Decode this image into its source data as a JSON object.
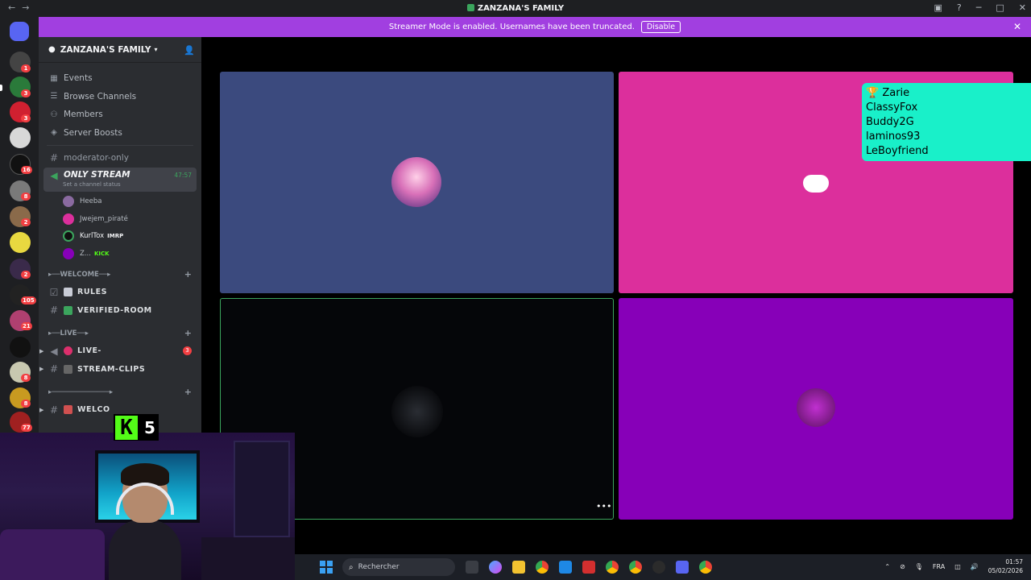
{
  "titlebar": {
    "title": "ZANZANA'S FAMILY"
  },
  "banner": {
    "text": "Streamer Mode is enabled. Usernames have been truncated.",
    "disable_label": "Disable"
  },
  "server": {
    "name": "ZANZANA'S FAMILY",
    "menu": [
      {
        "label": "Events",
        "icon": "calendar-icon"
      },
      {
        "label": "Browse Channels",
        "icon": "browse-channels-icon"
      },
      {
        "label": "Members",
        "icon": "members-icon"
      },
      {
        "label": "Server Boosts",
        "icon": "boost-icon"
      }
    ],
    "channels": {
      "moderator": "moderator-only",
      "active_voice": {
        "name": "ONLY STREAM",
        "status": "Set a channel status",
        "time": "47:57"
      },
      "voice_users": [
        {
          "name": "Heeba",
          "tag": ""
        },
        {
          "name": "Jwejem_piraté",
          "tag": ""
        },
        {
          "name": "KurlTox",
          "tag": "IMRP"
        },
        {
          "name": "Z...",
          "tag": "KICK"
        }
      ],
      "cat_welcome": "WELCOME",
      "rules": "RULES",
      "verified": "VERIFIED-ROOM",
      "cat_live": "LIVE",
      "live": "LIVE-",
      "live_badge": "3",
      "clips": "STREAM-CLIPS",
      "welcome_partial": "WELCO"
    }
  },
  "server_badges": [
    "1",
    "3",
    "3",
    "16",
    "8",
    "2",
    "2",
    "105",
    "21",
    "8",
    "8",
    "77"
  ],
  "leaderboard": {
    "entries": [
      "Zarie",
      "ClassyFox",
      "Buddy2G",
      "laminos93",
      "LeBoyfriend"
    ]
  },
  "kick_overlay": {
    "count": "5"
  },
  "taskbar": {
    "search_placeholder": "Rechercher",
    "lang": "FRA",
    "time": "01:57",
    "date": "05/02/2026"
  }
}
